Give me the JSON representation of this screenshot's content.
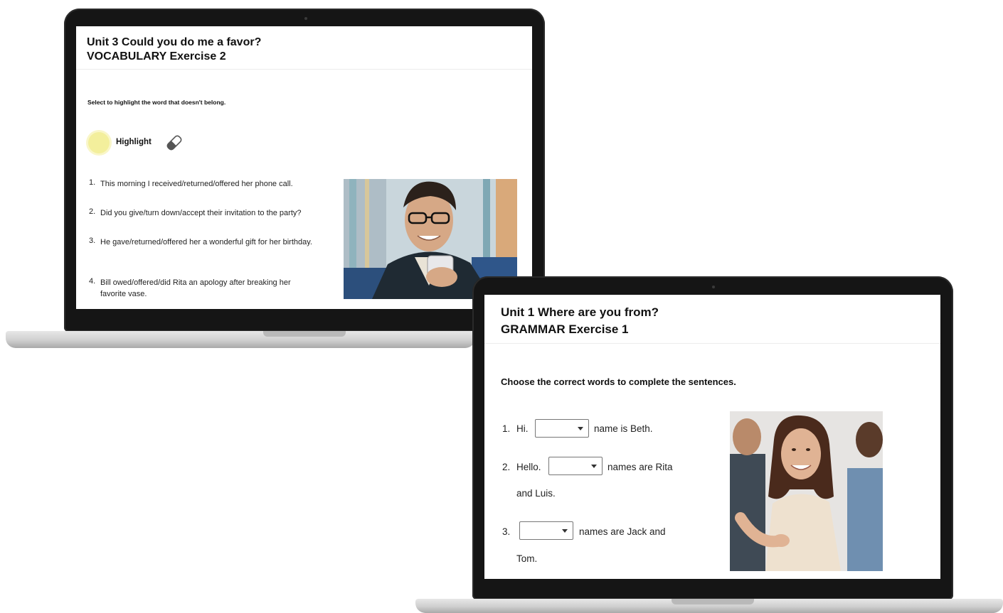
{
  "laptop_left": {
    "title": "Unit 3 Could you do me a favor?",
    "subtitle": "VOCABULARY Exercise 2",
    "instruction": "Select to highlight the word that doesn't belong.",
    "highlight_label": "Highlight",
    "highlight_color": "#f3ef9c",
    "tool_icon": "eraser-icon",
    "questions": [
      {
        "num": "1.",
        "text": "This morning I received/returned/offered her phone call."
      },
      {
        "num": "2.",
        "text": "Did you give/turn down/accept their invitation to the party?"
      },
      {
        "num": "3.",
        "text": "He gave/returned/offered her a wonderful gift for her birthday."
      },
      {
        "num": "4.",
        "text": "Bill owed/offered/did Rita an apology after breaking her favorite vase."
      }
    ]
  },
  "laptop_right": {
    "title": "Unit 1 Where are you from?",
    "subtitle": "GRAMMAR Exercise 1",
    "instruction": "Choose the correct words to complete the sentences.",
    "questions": [
      {
        "num": "1.",
        "before": "Hi.",
        "after": "name is Beth.",
        "cont": ""
      },
      {
        "num": "2.",
        "before": "Hello.",
        "after": "names are Rita",
        "cont": "and Luis."
      },
      {
        "num": "3.",
        "before": "",
        "after": "names are Jack and",
        "cont": "Tom."
      }
    ]
  }
}
